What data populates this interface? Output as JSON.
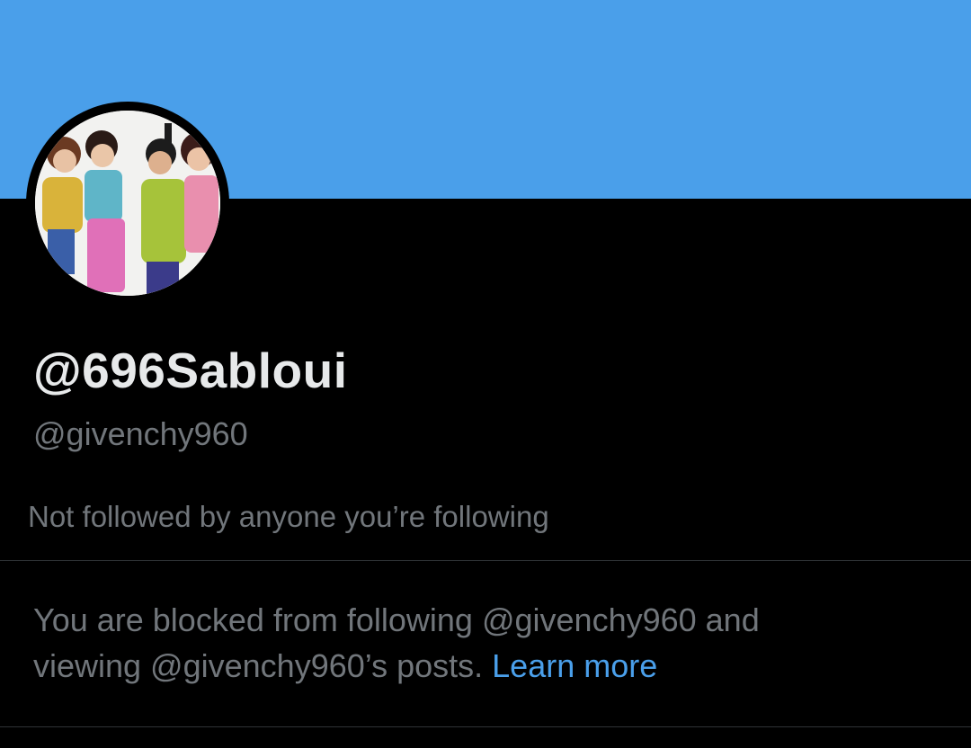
{
  "profile": {
    "display_name": "@696Sabloui",
    "handle": "@givenchy960",
    "follow_context": "Not followed by anyone you’re following",
    "avatar_icon": "profile-photo"
  },
  "blocked_notice": {
    "text_line1": "You are blocked from following @givenchy960 and",
    "text_line2": "viewing @givenchy960’s posts. ",
    "learn_more_label": "Learn more"
  },
  "colors": {
    "banner": "#4a9fea",
    "background": "#000000",
    "primary_text": "#e7e9ea",
    "secondary_text": "#71767b",
    "link": "#4a9fea",
    "divider": "#2f3336"
  }
}
